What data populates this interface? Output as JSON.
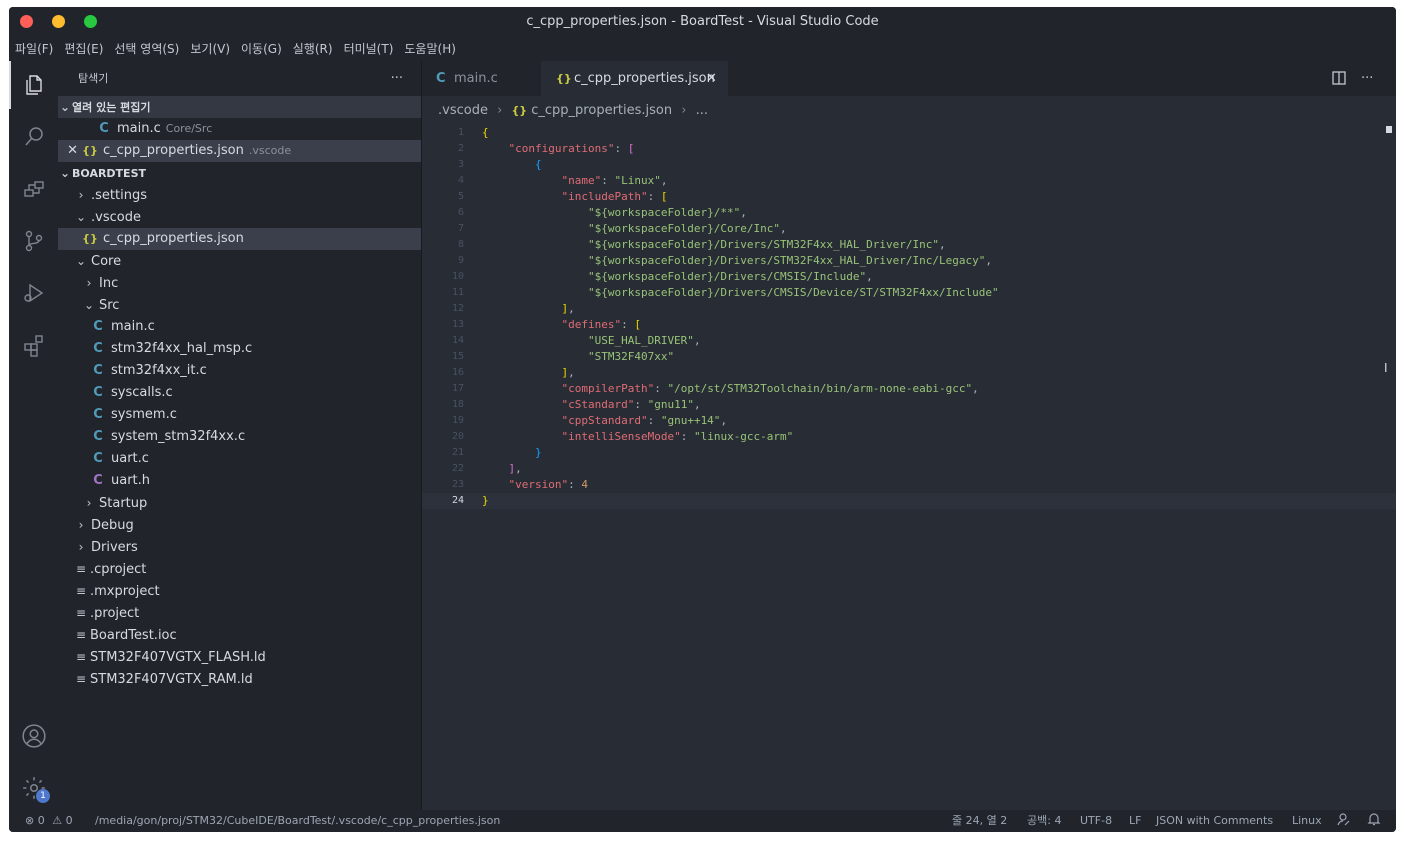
{
  "window": {
    "title": "c_cpp_properties.json - BoardTest - Visual Studio Code",
    "traffic_colors": [
      "#ff5f57",
      "#febc2e",
      "#28c840"
    ]
  },
  "menu": [
    "파일(F)",
    "편집(E)",
    "선택 영역(S)",
    "보기(V)",
    "이동(G)",
    "실행(R)",
    "터미널(T)",
    "도움말(H)"
  ],
  "activity": {
    "items": [
      "explorer-icon",
      "search-icon",
      "remote-explorer-icon",
      "source-control-icon",
      "run-debug-icon",
      "extensions-icon"
    ],
    "bottom": [
      "account-icon",
      "settings-gear-icon"
    ],
    "settings_badge": "1"
  },
  "sidebar": {
    "title": "탐색기",
    "more": "···",
    "open_editors_header": "열려 있는 편집기",
    "open_editors": [
      {
        "icon": "C",
        "name": "main.c",
        "desc": "Core/Src"
      },
      {
        "icon": "{}",
        "name": "c_cpp_properties.json",
        "desc": ".vscode"
      }
    ],
    "project_header": "BOARDTEST",
    "tree": [
      {
        "name": ".settings",
        "type": "folder",
        "open": false,
        "depth": 0
      },
      {
        "name": ".vscode",
        "type": "folder",
        "open": true,
        "depth": 0
      },
      {
        "name": "c_cpp_properties.json",
        "type": "json",
        "depth": 1,
        "selected": true
      },
      {
        "name": "Core",
        "type": "folder",
        "open": true,
        "depth": 0
      },
      {
        "name": "Inc",
        "type": "folder",
        "open": false,
        "depth": 1
      },
      {
        "name": "Src",
        "type": "folder",
        "open": true,
        "depth": 1
      },
      {
        "name": "main.c",
        "type": "c",
        "depth": 2
      },
      {
        "name": "stm32f4xx_hal_msp.c",
        "type": "c",
        "depth": 2
      },
      {
        "name": "stm32f4xx_it.c",
        "type": "c",
        "depth": 2
      },
      {
        "name": "syscalls.c",
        "type": "c",
        "depth": 2
      },
      {
        "name": "sysmem.c",
        "type": "c",
        "depth": 2
      },
      {
        "name": "system_stm32f4xx.c",
        "type": "c",
        "depth": 2
      },
      {
        "name": "uart.c",
        "type": "c",
        "depth": 2
      },
      {
        "name": "uart.h",
        "type": "h",
        "depth": 2
      },
      {
        "name": "Startup",
        "type": "folder",
        "open": false,
        "depth": 1
      },
      {
        "name": "Debug",
        "type": "folder",
        "open": false,
        "depth": 0
      },
      {
        "name": "Drivers",
        "type": "folder",
        "open": false,
        "depth": 0
      },
      {
        "name": ".cproject",
        "type": "file",
        "depth": 0
      },
      {
        "name": ".mxproject",
        "type": "file",
        "depth": 0
      },
      {
        "name": ".project",
        "type": "file",
        "depth": 0
      },
      {
        "name": "BoardTest.ioc",
        "type": "file",
        "depth": 0
      },
      {
        "name": "STM32F407VGTX_FLASH.ld",
        "type": "file",
        "depth": 0
      },
      {
        "name": "STM32F407VGTX_RAM.ld",
        "type": "file",
        "depth": 0
      }
    ]
  },
  "tabs": [
    {
      "icon": "C",
      "label": "main.c",
      "active": false
    },
    {
      "icon": "{}",
      "label": "c_cpp_properties.json",
      "active": true,
      "close": "✕"
    }
  ],
  "breadcrumb": [
    ".vscode",
    "{} c_cpp_properties.json",
    "..."
  ],
  "code_lines": [
    "{",
    "    \"configurations\": [",
    "        {",
    "            \"name\": \"Linux\",",
    "            \"includePath\": [",
    "                \"${workspaceFolder}/**\",",
    "                \"${workspaceFolder}/Core/Inc\",",
    "                \"${workspaceFolder}/Drivers/STM32F4xx_HAL_Driver/Inc\",",
    "                \"${workspaceFolder}/Drivers/STM32F4xx_HAL_Driver/Inc/Legacy\",",
    "                \"${workspaceFolder}/Drivers/CMSIS/Include\",",
    "                \"${workspaceFolder}/Drivers/CMSIS/Device/ST/STM32F4xx/Include\"",
    "            ],",
    "            \"defines\": [",
    "                \"USE_HAL_DRIVER\",",
    "                \"STM32F407xx\"",
    "            ],",
    "            \"compilerPath\": \"/opt/st/STM32Toolchain/bin/arm-none-eabi-gcc\",",
    "            \"cStandard\": \"gnu11\",",
    "            \"cppStandard\": \"gnu++14\",",
    "            \"intelliSenseMode\": \"linux-gcc-arm\"",
    "        }",
    "    ],",
    "    \"version\": 4",
    "}"
  ],
  "current_line": 24,
  "status": {
    "errors": "0",
    "warnings": "0",
    "path": "/media/gon/proj/STM32/CubeIDE/BoardTest/.vscode/c_cpp_properties.json",
    "position": "줄 24, 열 2",
    "spaces": "공백: 4",
    "encoding": "UTF-8",
    "eol": "LF",
    "language": "JSON with Comments",
    "platform": "Linux"
  }
}
